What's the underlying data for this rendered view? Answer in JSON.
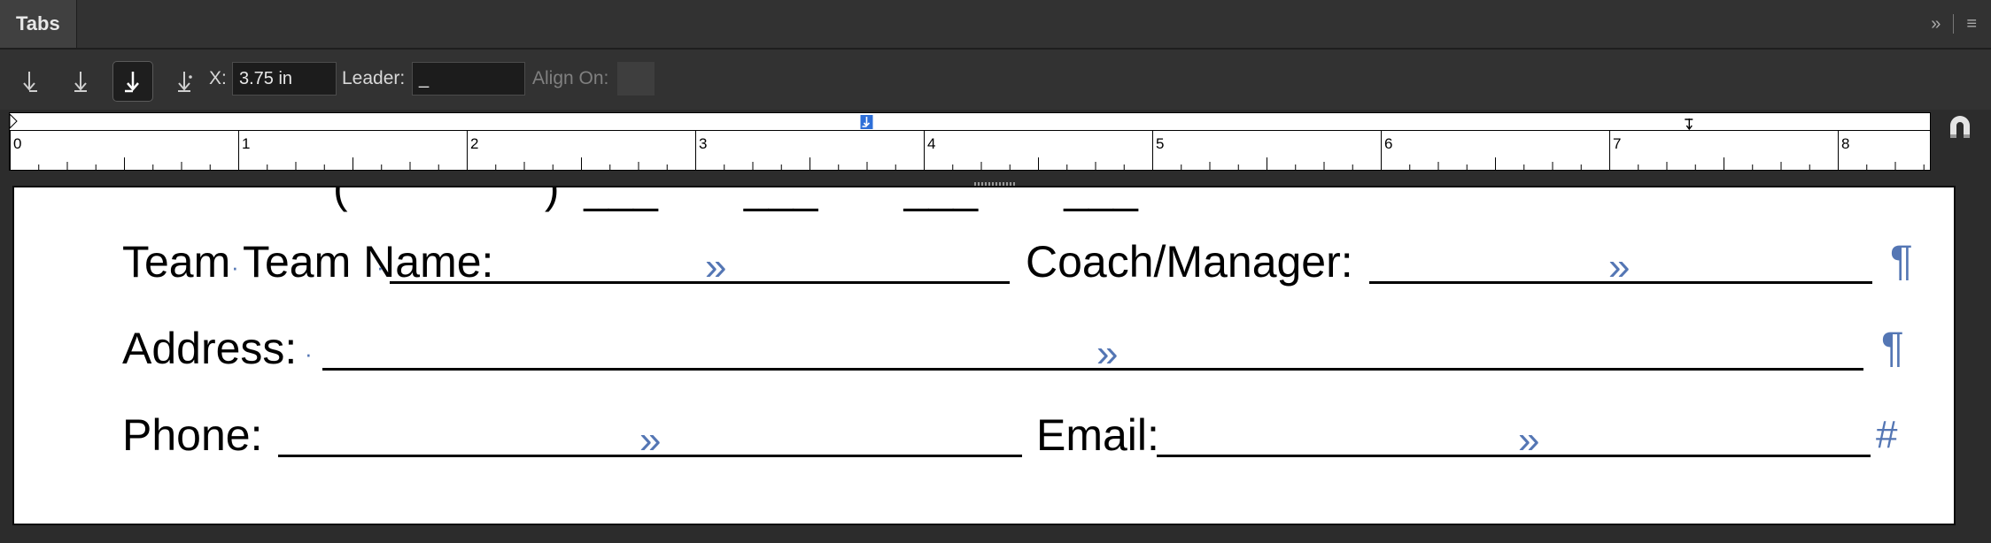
{
  "panel": {
    "tab_label": "Tabs",
    "collapse_glyph": "»",
    "menu_glyph": "≡"
  },
  "toolbar": {
    "tools": [
      {
        "name": "left-justified-tab-icon",
        "selected": false
      },
      {
        "name": "center-justified-tab-icon",
        "selected": false
      },
      {
        "name": "right-justified-tab-icon",
        "selected": true
      },
      {
        "name": "align-to-decimal-tab-icon",
        "selected": false
      }
    ],
    "x_label": "X:",
    "x_value": "3.75 in",
    "leader_label": "Leader:",
    "leader_value": "_",
    "align_on_label": "Align On:",
    "align_on_value": ""
  },
  "ruler": {
    "unit_labels": [
      "0",
      "1",
      "2",
      "3",
      "4",
      "5",
      "6",
      "7",
      "8"
    ],
    "selected_tab_position_in": 3.75,
    "right_indent_marker_in": 7.35,
    "accent_color": "#2e6fd8"
  },
  "document": {
    "row1": {
      "label1": "Team Name:",
      "label2": "Coach/Manager:",
      "end_mark": "¶"
    },
    "row2": {
      "label1": "Address:",
      "end_mark": "¶"
    },
    "row3": {
      "label1": "Phone:",
      "label2": "Email:",
      "end_mark": "#"
    },
    "tab_glyph": "»",
    "hidden_char_color": "#5476b4"
  }
}
